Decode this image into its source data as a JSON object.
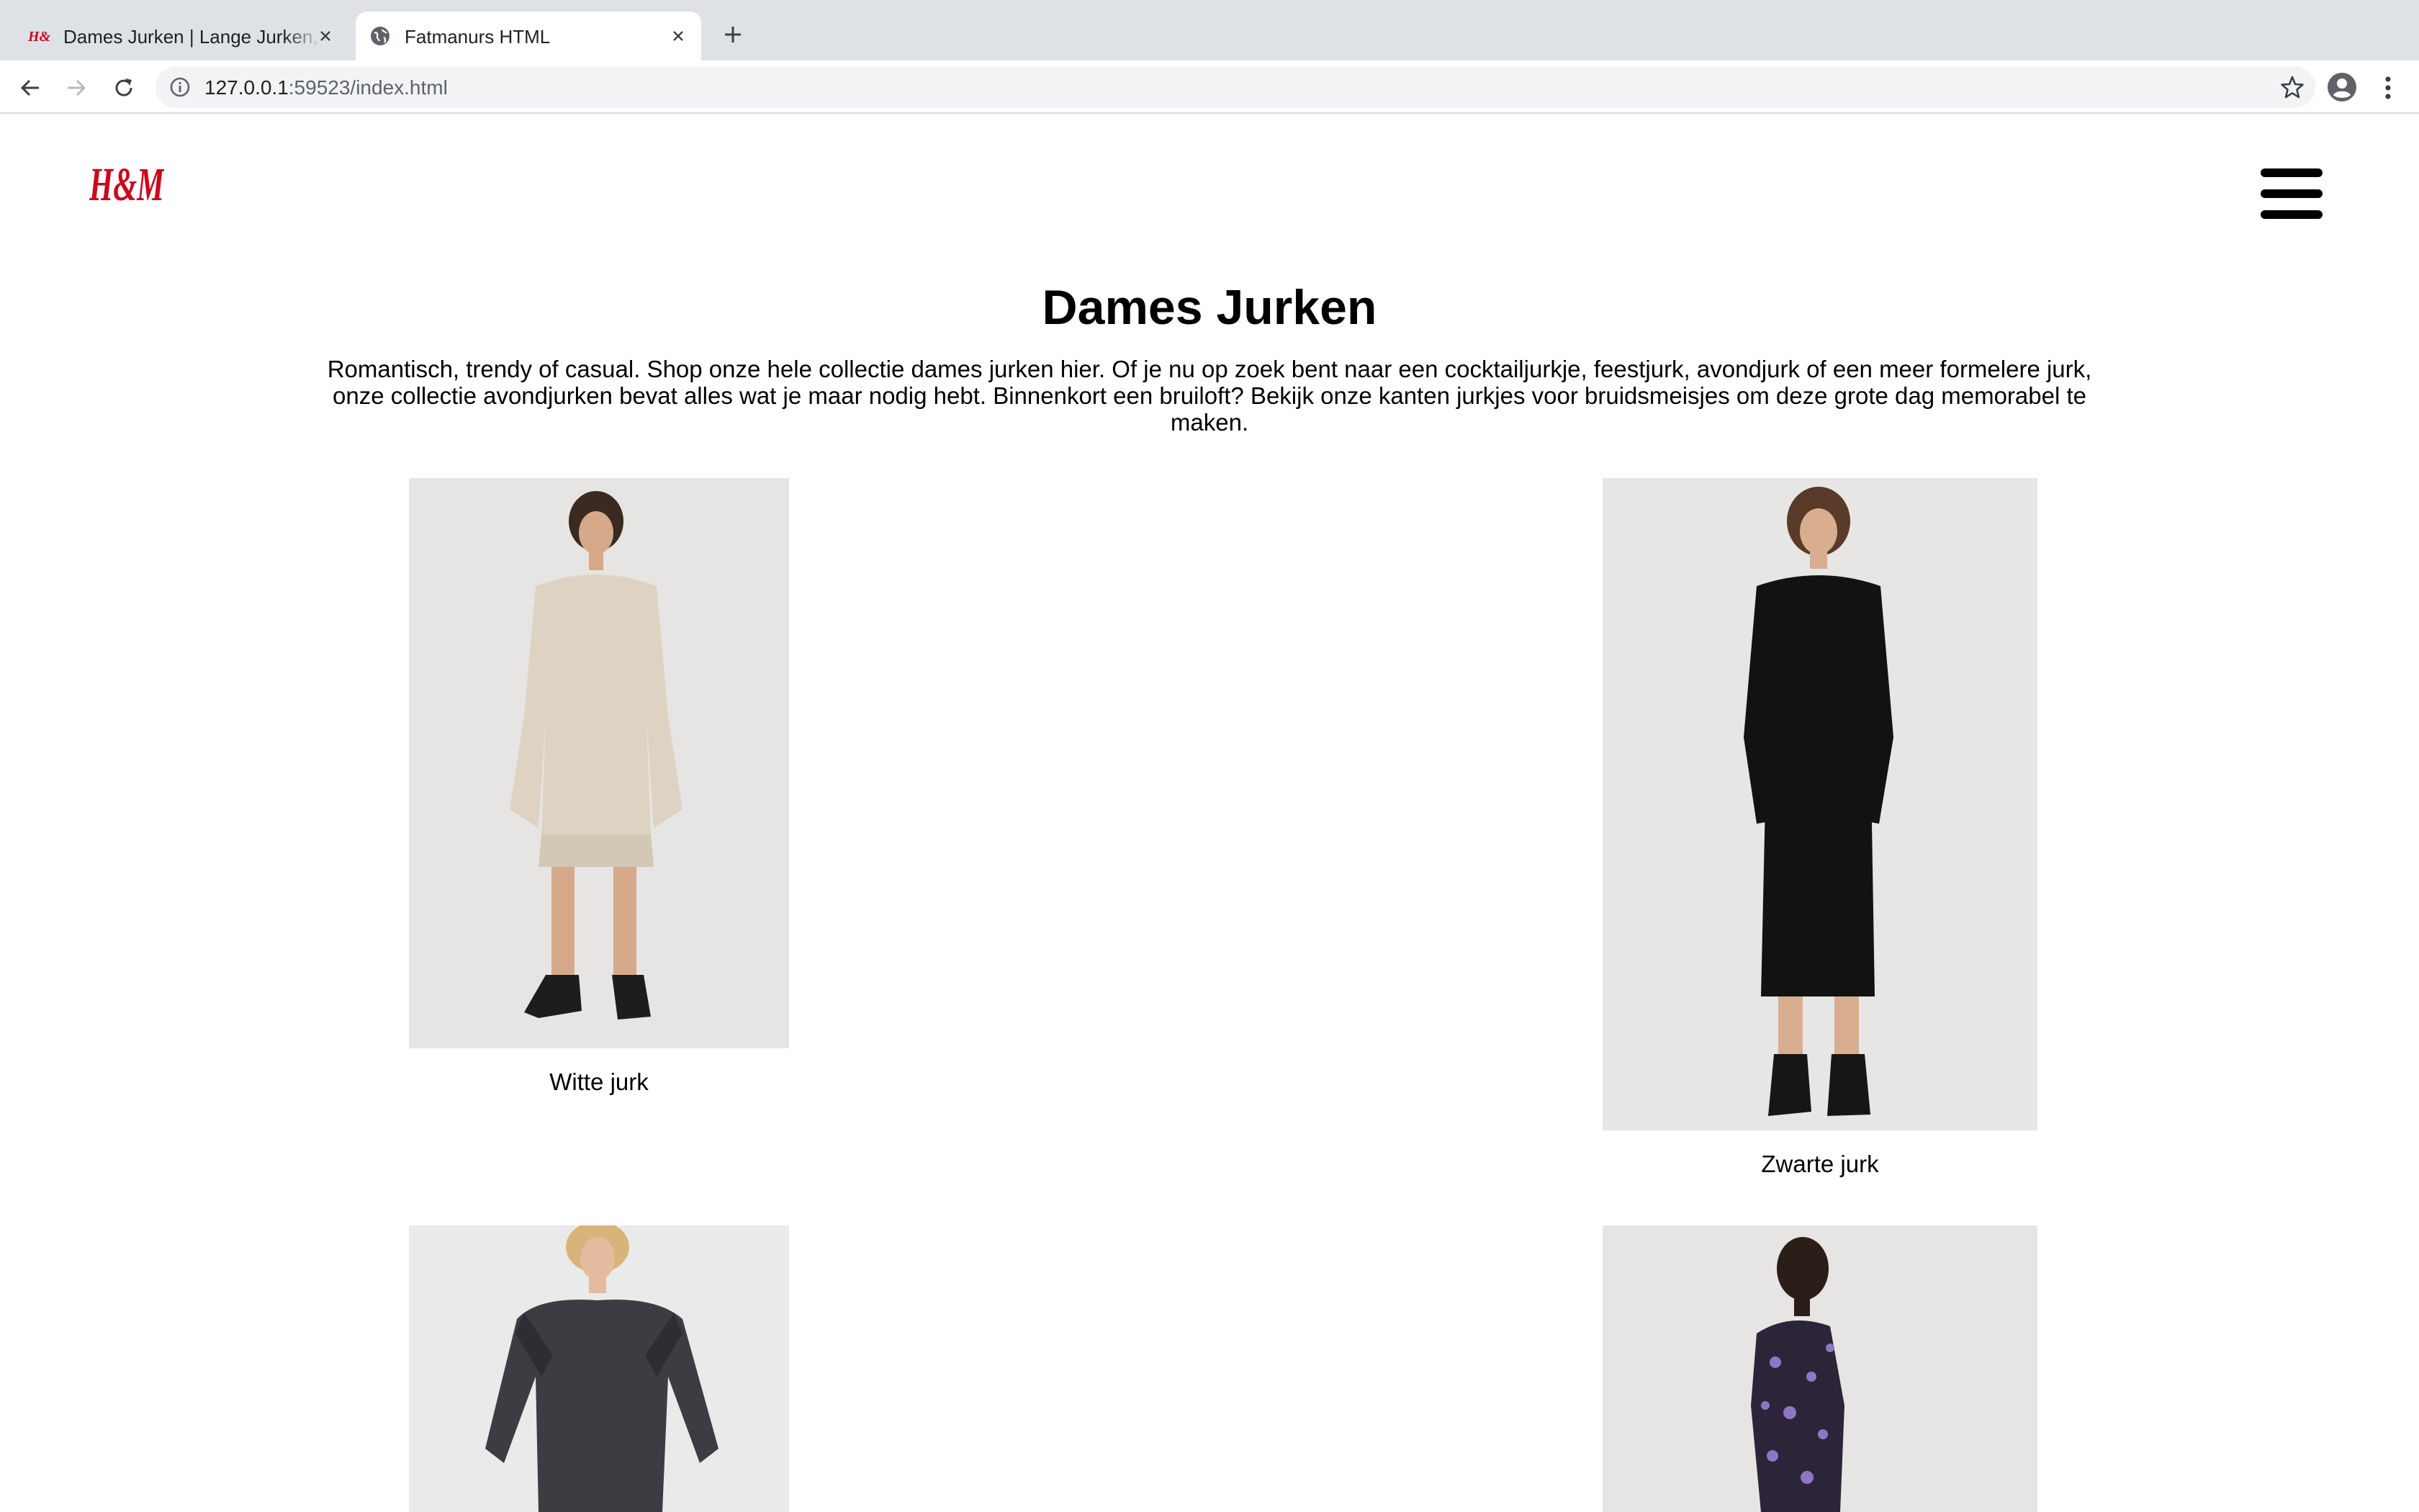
{
  "browser": {
    "tabs": [
      {
        "title": "Dames Jurken | Lange Jurken,",
        "favicon": "hm-logo-icon",
        "active": false
      },
      {
        "title": "Fatmanurs HTML",
        "favicon": "globe-icon",
        "active": true
      }
    ],
    "address": {
      "host": "127.0.0.1",
      "rest": ":59523/index.html"
    }
  },
  "site": {
    "logo_text": "H&M",
    "brand_color": "#cc071e",
    "menu_icon": "hamburger-menu-icon"
  },
  "page": {
    "title": "Dames Jurken",
    "intro": "Romantisch, trendy of casual. Shop onze hele collectie dames jurken hier. Of je nu op zoek bent naar een cocktailjurkje, feestjurk, avondjurk of een meer formelere jurk, onze collectie avondjurken bevat alles wat je maar nodig hebt. Binnenkort een bruiloft? Bekijk onze kanten jurkjes voor bruidsmeisjes om deze grote dag memorabel te maken."
  },
  "products": [
    {
      "caption": "Witte jurk"
    },
    {
      "caption": "Zwarte jurk"
    },
    {
      "caption": ""
    },
    {
      "caption": ""
    }
  ]
}
